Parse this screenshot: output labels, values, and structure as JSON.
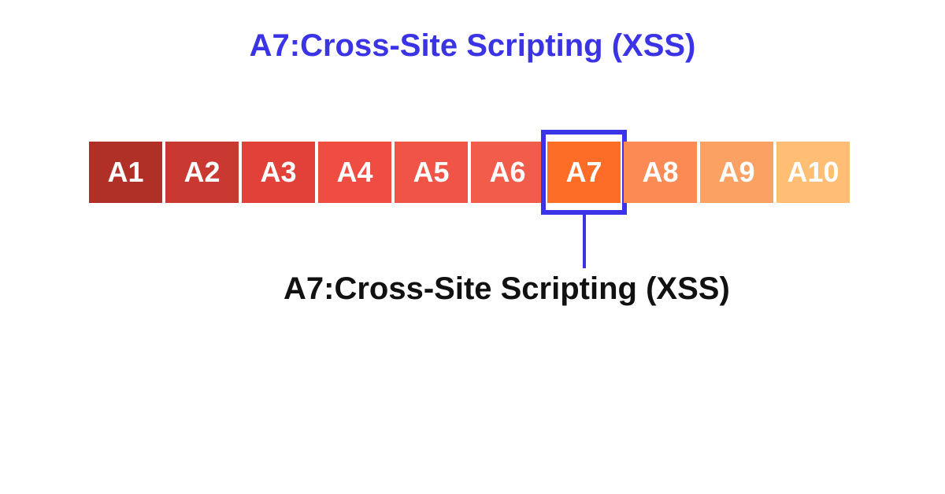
{
  "title": "A7:Cross-Site Scripting (XSS)",
  "callout": "A7:Cross-Site Scripting (XSS)",
  "highlight_index": 6,
  "cells": [
    {
      "label": "A1",
      "color": "#b03028"
    },
    {
      "label": "A2",
      "color": "#c93931"
    },
    {
      "label": "A3",
      "color": "#e14138"
    },
    {
      "label": "A4",
      "color": "#ef4c42"
    },
    {
      "label": "A5",
      "color": "#f05447"
    },
    {
      "label": "A6",
      "color": "#f25c4b"
    },
    {
      "label": "A7",
      "color": "#fd6d27"
    },
    {
      "label": "A8",
      "color": "#fb8a55"
    },
    {
      "label": "A9",
      "color": "#fca164"
    },
    {
      "label": "A10",
      "color": "#ffbe74"
    }
  ],
  "colors": {
    "accent": "#3b33e6",
    "text_dark": "#111111",
    "cell_text": "#ffffff"
  }
}
